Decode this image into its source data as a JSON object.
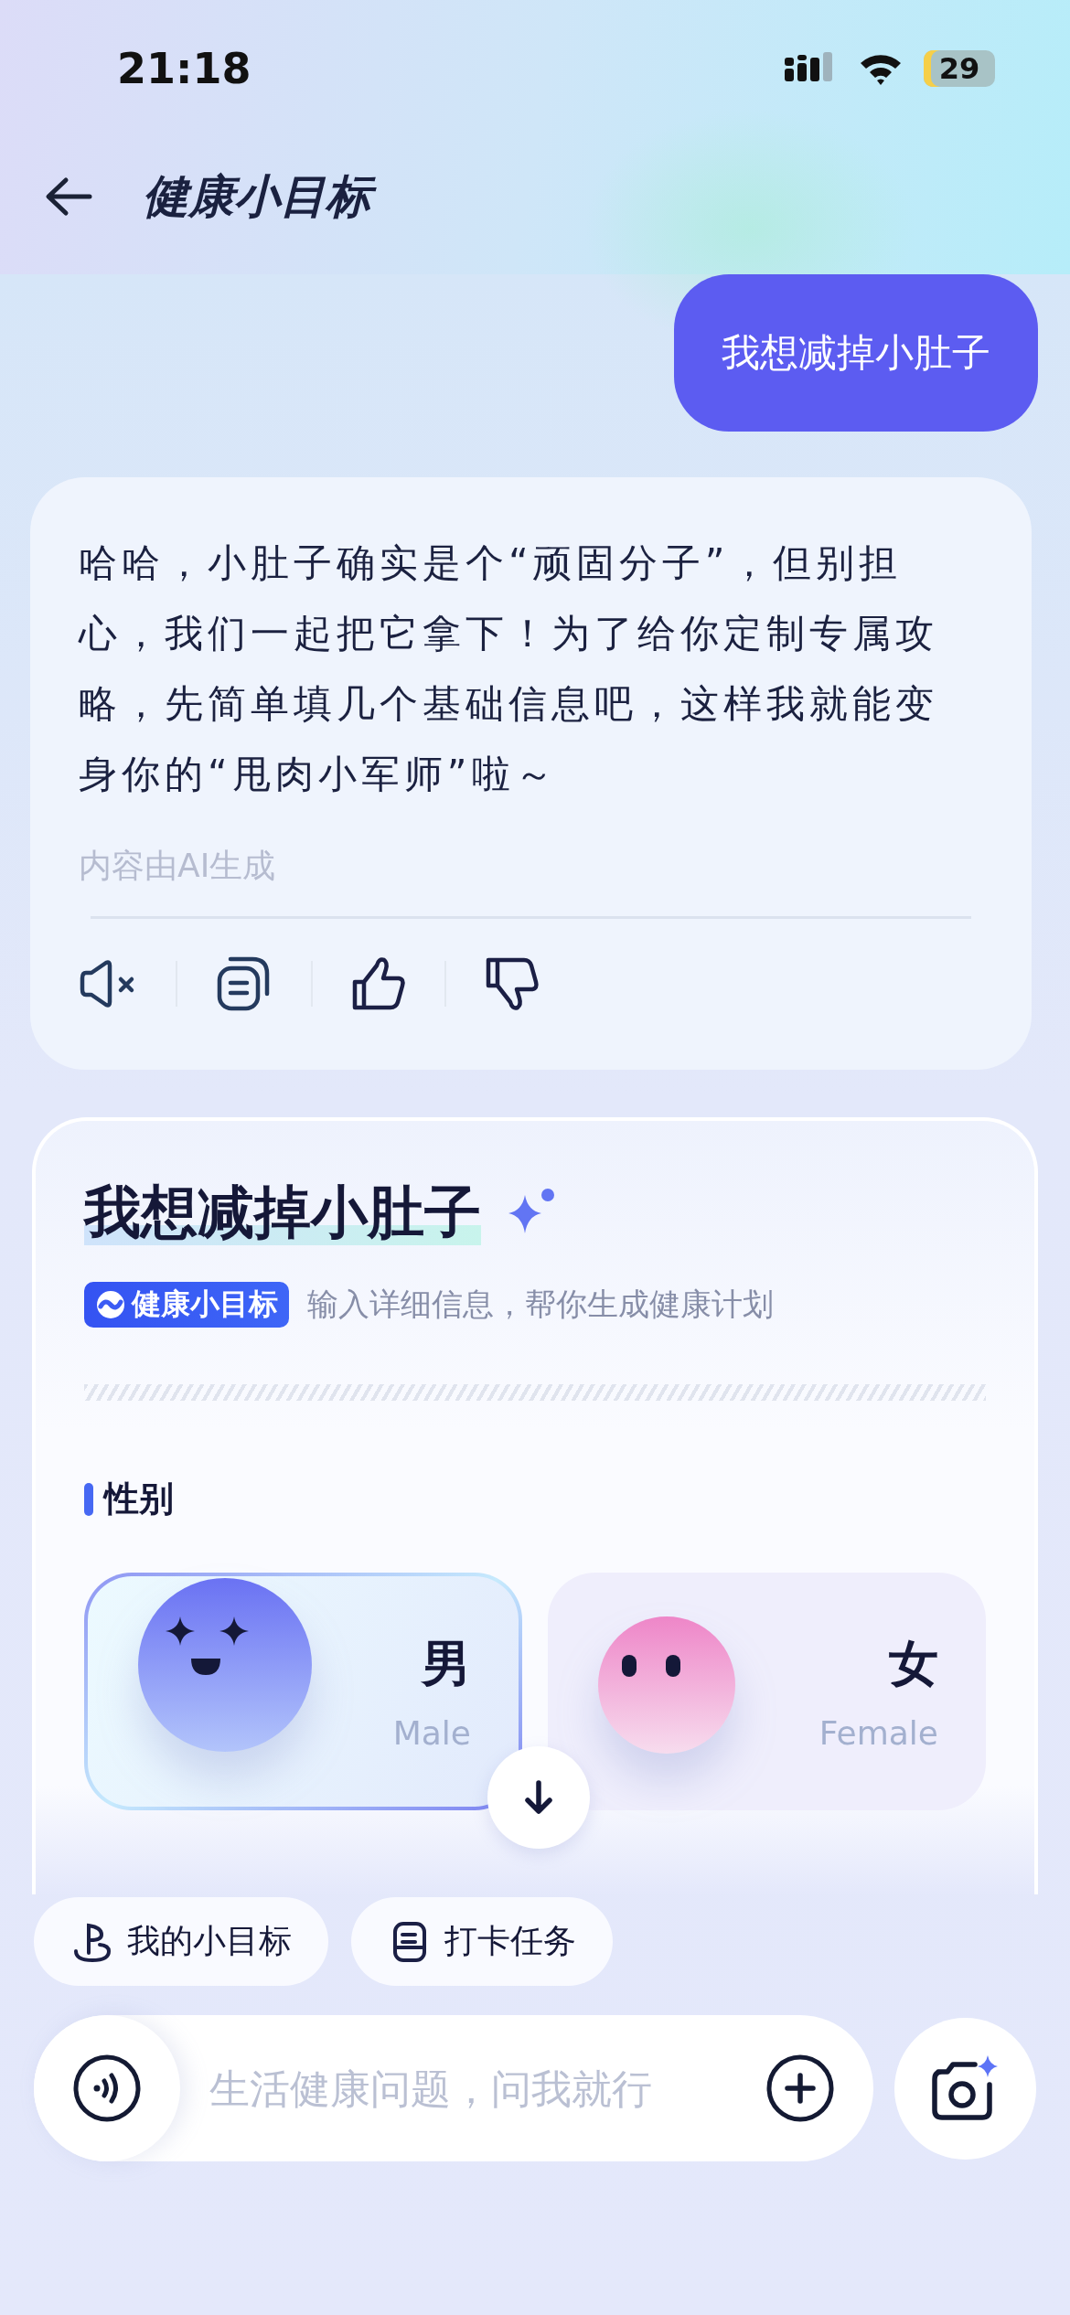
{
  "status_bar": {
    "time": "21:18",
    "battery": "29"
  },
  "header": {
    "title": "健康小目标"
  },
  "messages": [
    {
      "kind": "user",
      "text": "我想减掉小肚子"
    },
    {
      "kind": "assistant",
      "text": "哈哈，小肚子确实是个“顽固分子”，但别担心，我们一起把它拿下！为了给你定制专属攻略，先简单填几个基础信息吧，这样我就能变身你的“甩肉小军师”啦～",
      "note": "内容由AI生成"
    }
  ],
  "form": {
    "title": "我想减掉小肚子",
    "badge": "健康小目标",
    "subtitle": "输入详细信息，帮你生成健康计划",
    "section": "性别",
    "options": [
      {
        "kind": "male",
        "label": "男",
        "sublabel": "Male",
        "selected": true
      },
      {
        "kind": "female",
        "label": "女",
        "sublabel": "Female",
        "selected": false
      }
    ]
  },
  "shortcuts": [
    {
      "kind": "flag",
      "label": "我的小目标"
    },
    {
      "kind": "tasks",
      "label": "打卡任务"
    }
  ],
  "composer": {
    "placeholder": "生活健康问题，问我就行"
  }
}
